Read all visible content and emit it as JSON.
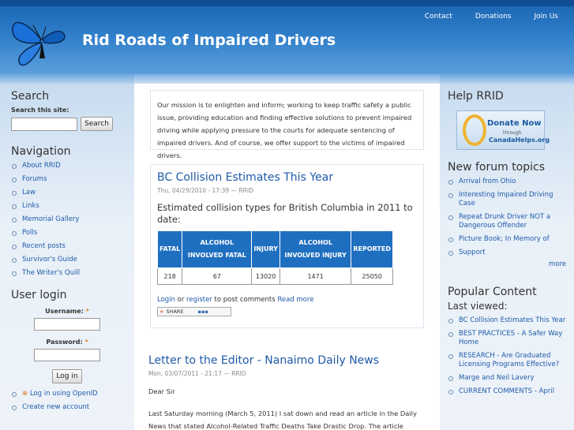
{
  "header": {
    "site_name": "Rid Roads of Impaired Drivers",
    "nav": [
      "Contact",
      "Donations",
      "Join Us"
    ]
  },
  "left": {
    "search": {
      "title": "Search",
      "label": "Search this site:",
      "value": "",
      "button": "Search"
    },
    "navigation": {
      "title": "Navigation",
      "items": [
        "About RRID",
        "Forums",
        "Law",
        "Links",
        "Memorial Gallery",
        "Polls",
        "Recent posts",
        "Survivor's Guide",
        "The Writer's Quill"
      ]
    },
    "login": {
      "title": "User login",
      "username_label": "Username:",
      "password_label": "Password:",
      "required": "*",
      "button": "Log in",
      "openid": "Log in using OpenID",
      "create": "Create new account"
    }
  },
  "main": {
    "mission": "Our mission is to enlighten and inform; working to keep traffic safety a public issue, providing education and finding effective solutions to prevent impaired driving while applying pressure to the courts for adequate sentencing of impaired drivers. And of course, we offer support to the victims of impaired drivers.",
    "node1": {
      "title": "BC Collision Estimates This Year",
      "submitted": "Thu, 04/29/2010 - 17:39 — RRID",
      "lead": "Estimated collision types for British Columbia in 2011 to date:",
      "table": {
        "headers": [
          "FATAL",
          "ALCOHOL INVOLVED FATAL",
          "INJURY",
          "ALCOHOL INVOLVED INJURY",
          "REPORTED"
        ],
        "row": [
          "218",
          "67",
          "13020",
          "1471",
          "25050"
        ]
      },
      "login_link": "Login",
      "or": "or",
      "register_link": "register",
      "post_comments": "to post comments",
      "read_more": "Read more",
      "share": "SHARE"
    },
    "node2": {
      "title": "Letter to the Editor - Nanaimo Daily News",
      "submitted": "Mon, 03/07/2011 - 21:17 — RRID",
      "greeting": "Dear Sir",
      "body": "Last Saturday morning (March 5, 2011) I sat down and read an article in the Daily News that stated Alcohol-Related Traffic Deaths Take Drastic Drop. The article stated"
    }
  },
  "right": {
    "help": {
      "title": "Help RRID",
      "donate_line1": "Donate Now",
      "donate_line2": "through",
      "donate_line3": "CanadaHelps.org"
    },
    "forum": {
      "title": "New forum topics",
      "items": [
        "Arrival from Ohio",
        "Interesting Impaired Driving Case",
        "Repeat Drunk Driver NOT a Dangerous Offender",
        "Picture Book; In Memory of",
        "Support"
      ],
      "more": "more"
    },
    "popular": {
      "title": "Popular Content",
      "subtitle": "Last viewed:",
      "items": [
        "BC Collision Estimates This Year",
        "BEST PRACTICES - A Safer Way Home",
        "RESEARCH - Are Graduated Licensing Programs Effective?",
        "Marge and Neil Lavery",
        "CURRENT COMMENTS - April"
      ]
    }
  }
}
